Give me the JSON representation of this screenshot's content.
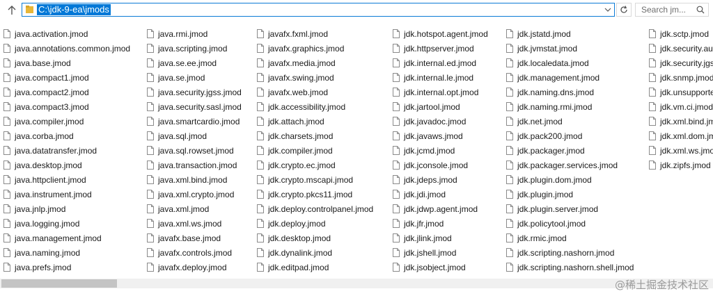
{
  "address_bar": {
    "path": "C:\\jdk-9-ea\\jmods"
  },
  "search": {
    "placeholder": "Search jm..."
  },
  "watermark": "@稀土掘金技术社区",
  "files": {
    "col1": [
      "java.activation.jmod",
      "java.annotations.common.jmod",
      "java.base.jmod",
      "java.compact1.jmod",
      "java.compact2.jmod",
      "java.compact3.jmod",
      "java.compiler.jmod",
      "java.corba.jmod",
      "java.datatransfer.jmod",
      "java.desktop.jmod",
      "java.httpclient.jmod",
      "java.instrument.jmod",
      "java.jnlp.jmod",
      "java.logging.jmod",
      "java.management.jmod",
      "java.naming.jmod",
      "java.prefs.jmod"
    ],
    "col2": [
      "java.rmi.jmod",
      "java.scripting.jmod",
      "java.se.ee.jmod",
      "java.se.jmod",
      "java.security.jgss.jmod",
      "java.security.sasl.jmod",
      "java.smartcardio.jmod",
      "java.sql.jmod",
      "java.sql.rowset.jmod",
      "java.transaction.jmod",
      "java.xml.bind.jmod",
      "java.xml.crypto.jmod",
      "java.xml.jmod",
      "java.xml.ws.jmod",
      "javafx.base.jmod",
      "javafx.controls.jmod",
      "javafx.deploy.jmod"
    ],
    "col3": [
      "javafx.fxml.jmod",
      "javafx.graphics.jmod",
      "javafx.media.jmod",
      "javafx.swing.jmod",
      "javafx.web.jmod",
      "jdk.accessibility.jmod",
      "jdk.attach.jmod",
      "jdk.charsets.jmod",
      "jdk.compiler.jmod",
      "jdk.crypto.ec.jmod",
      "jdk.crypto.mscapi.jmod",
      "jdk.crypto.pkcs11.jmod",
      "jdk.deploy.controlpanel.jmod",
      "jdk.deploy.jmod",
      "jdk.desktop.jmod",
      "jdk.dynalink.jmod",
      "jdk.editpad.jmod"
    ],
    "col4": [
      "jdk.hotspot.agent.jmod",
      "jdk.httpserver.jmod",
      "jdk.internal.ed.jmod",
      "jdk.internal.le.jmod",
      "jdk.internal.opt.jmod",
      "jdk.jartool.jmod",
      "jdk.javadoc.jmod",
      "jdk.javaws.jmod",
      "jdk.jcmd.jmod",
      "jdk.jconsole.jmod",
      "jdk.jdeps.jmod",
      "jdk.jdi.jmod",
      "jdk.jdwp.agent.jmod",
      "jdk.jfr.jmod",
      "jdk.jlink.jmod",
      "jdk.jshell.jmod",
      "jdk.jsobject.jmod"
    ],
    "col5": [
      "jdk.jstatd.jmod",
      "jdk.jvmstat.jmod",
      "jdk.localedata.jmod",
      "jdk.management.jmod",
      "jdk.naming.dns.jmod",
      "jdk.naming.rmi.jmod",
      "jdk.net.jmod",
      "jdk.pack200.jmod",
      "jdk.packager.jmod",
      "jdk.packager.services.jmod",
      "jdk.plugin.dom.jmod",
      "jdk.plugin.jmod",
      "jdk.plugin.server.jmod",
      "jdk.policytool.jmod",
      "jdk.rmic.jmod",
      "jdk.scripting.nashorn.jmod",
      "jdk.scripting.nashorn.shell.jmod"
    ],
    "col6": [
      "jdk.sctp.jmod",
      "jdk.security.aut",
      "jdk.security.jgss",
      "jdk.snmp.jmod",
      "jdk.unsupporte",
      "jdk.vm.ci.jmod",
      "jdk.xml.bind.jm",
      "jdk.xml.dom.jm",
      "jdk.xml.ws.jmo",
      "jdk.zipfs.jmod"
    ]
  }
}
